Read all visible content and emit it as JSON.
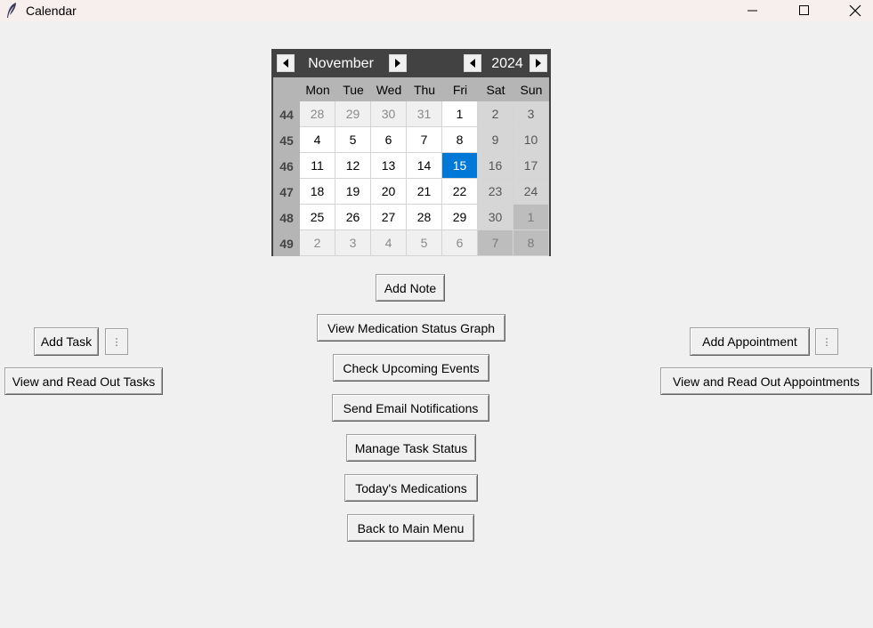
{
  "window": {
    "title": "Calendar",
    "icon": "feather-icon",
    "controls": [
      "minimize-icon",
      "maximize-icon",
      "close-icon"
    ]
  },
  "calendar": {
    "month": "November",
    "year": "2024",
    "day_names": [
      "Mon",
      "Tue",
      "Wed",
      "Thu",
      "Fri",
      "Sat",
      "Sun"
    ],
    "selected_day": "15",
    "selected_color": "#0078d7",
    "weeks": [
      {
        "num": "44",
        "days": [
          [
            "28",
            "other"
          ],
          [
            "29",
            "other"
          ],
          [
            "30",
            "other"
          ],
          [
            "31",
            "other"
          ],
          [
            "1",
            "normal"
          ],
          [
            "2",
            "weekend"
          ],
          [
            "3",
            "weekend"
          ]
        ]
      },
      {
        "num": "45",
        "days": [
          [
            "4",
            "normal"
          ],
          [
            "5",
            "normal"
          ],
          [
            "6",
            "normal"
          ],
          [
            "7",
            "normal"
          ],
          [
            "8",
            "normal"
          ],
          [
            "9",
            "weekend"
          ],
          [
            "10",
            "weekend"
          ]
        ]
      },
      {
        "num": "46",
        "days": [
          [
            "11",
            "normal"
          ],
          [
            "12",
            "normal"
          ],
          [
            "13",
            "normal"
          ],
          [
            "14",
            "normal"
          ],
          [
            "15",
            "selected"
          ],
          [
            "16",
            "weekend"
          ],
          [
            "17",
            "weekend"
          ]
        ]
      },
      {
        "num": "47",
        "days": [
          [
            "18",
            "normal"
          ],
          [
            "19",
            "normal"
          ],
          [
            "20",
            "normal"
          ],
          [
            "21",
            "normal"
          ],
          [
            "22",
            "normal"
          ],
          [
            "23",
            "weekend"
          ],
          [
            "24",
            "weekend"
          ]
        ]
      },
      {
        "num": "48",
        "days": [
          [
            "25",
            "normal"
          ],
          [
            "26",
            "normal"
          ],
          [
            "27",
            "normal"
          ],
          [
            "28",
            "normal"
          ],
          [
            "29",
            "normal"
          ],
          [
            "30",
            "weekend"
          ],
          [
            "1",
            "other-weekend"
          ]
        ]
      },
      {
        "num": "49",
        "days": [
          [
            "2",
            "other"
          ],
          [
            "3",
            "other"
          ],
          [
            "4",
            "other"
          ],
          [
            "5",
            "other"
          ],
          [
            "6",
            "other"
          ],
          [
            "7",
            "other-weekend"
          ],
          [
            "8",
            "other-weekend"
          ]
        ]
      }
    ]
  },
  "left_panel": {
    "add_task": "Add Task",
    "menu_glyph": "⋮",
    "view_tasks": "View and Read Out Tasks"
  },
  "right_panel": {
    "add_appointment": "Add Appointment",
    "menu_glyph": "⋮",
    "view_appointments": "View and Read Out Appointments"
  },
  "center_buttons": {
    "add_note": "Add Note",
    "medication_graph": "View Medication Status Graph",
    "upcoming_events": "Check Upcoming Events",
    "email_notifications": "Send Email Notifications",
    "task_status": "Manage Task Status",
    "todays_medications": "Today's Medications",
    "back_main_menu": "Back to Main Menu"
  }
}
